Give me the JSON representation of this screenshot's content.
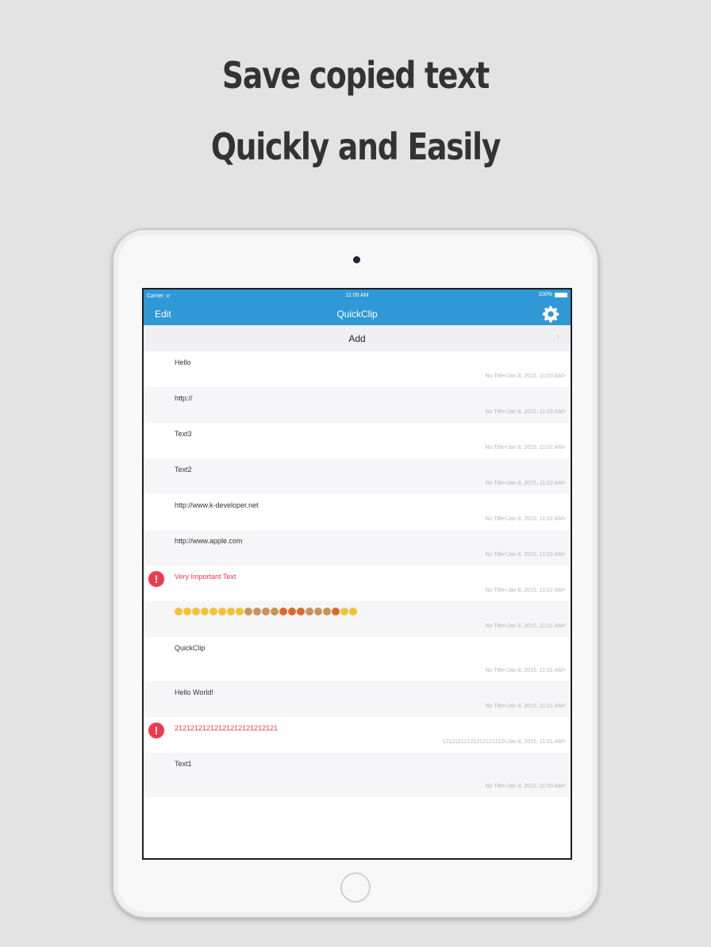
{
  "headline": {
    "line1": "Save copied text",
    "line2": "Quickly and Easily"
  },
  "status_bar": {
    "carrier": "Carrier ᯤ",
    "time": "11:06 AM",
    "battery": "100%"
  },
  "navbar": {
    "edit_label": "Edit",
    "title": "QuickClip",
    "settings_icon": "gear-icon"
  },
  "add_row": {
    "label": "Add",
    "chevron": "›"
  },
  "colors": {
    "nav_blue": "#2f98d6",
    "important_red": "#f0394d"
  },
  "clips": [
    {
      "text": "Hello",
      "meta": "No Title<Jan 8, 2015, 11:03 AM>",
      "important": false
    },
    {
      "text": "http://",
      "meta": "No Title<Jan 8, 2015, 11:03 AM>",
      "important": false
    },
    {
      "text": "Text3",
      "meta": "No Title<Jan 8, 2015, 11:02 AM>",
      "important": false
    },
    {
      "text": "Text2",
      "meta": "No Title<Jan 8, 2015, 11:02 AM>",
      "important": false
    },
    {
      "text": "http://www.k-developer.net",
      "meta": "No Title<Jan 8, 2015, 11:02 AM>",
      "important": false
    },
    {
      "text": "http://www.apple.com",
      "meta": "No Title<Jan 8, 2015, 11:02 AM>",
      "important": false
    },
    {
      "text": "Very Important Text",
      "meta": "No Title<Jan 8, 2015, 11:02 AM>",
      "important": true
    },
    {
      "text": "",
      "meta": "No Title<Jan 8, 2015, 11:01 AM>",
      "important": false,
      "emoji": true
    },
    {
      "text": "QuickClip",
      "meta": "No Title<Jan 8, 2015, 11:01 AM>",
      "important": false
    },
    {
      "text": "Hello World!",
      "meta": "No Title<Jan 8, 2015, 11:01 AM>",
      "important": false
    },
    {
      "text": "21212121212121212121212121",
      "meta": "12121212121212121212<Jan 8, 2015, 11:01 AM>",
      "important": true
    },
    {
      "text": "Text1",
      "meta": "No Title<Jan 8, 2015, 11:00 AM>",
      "important": false
    }
  ]
}
